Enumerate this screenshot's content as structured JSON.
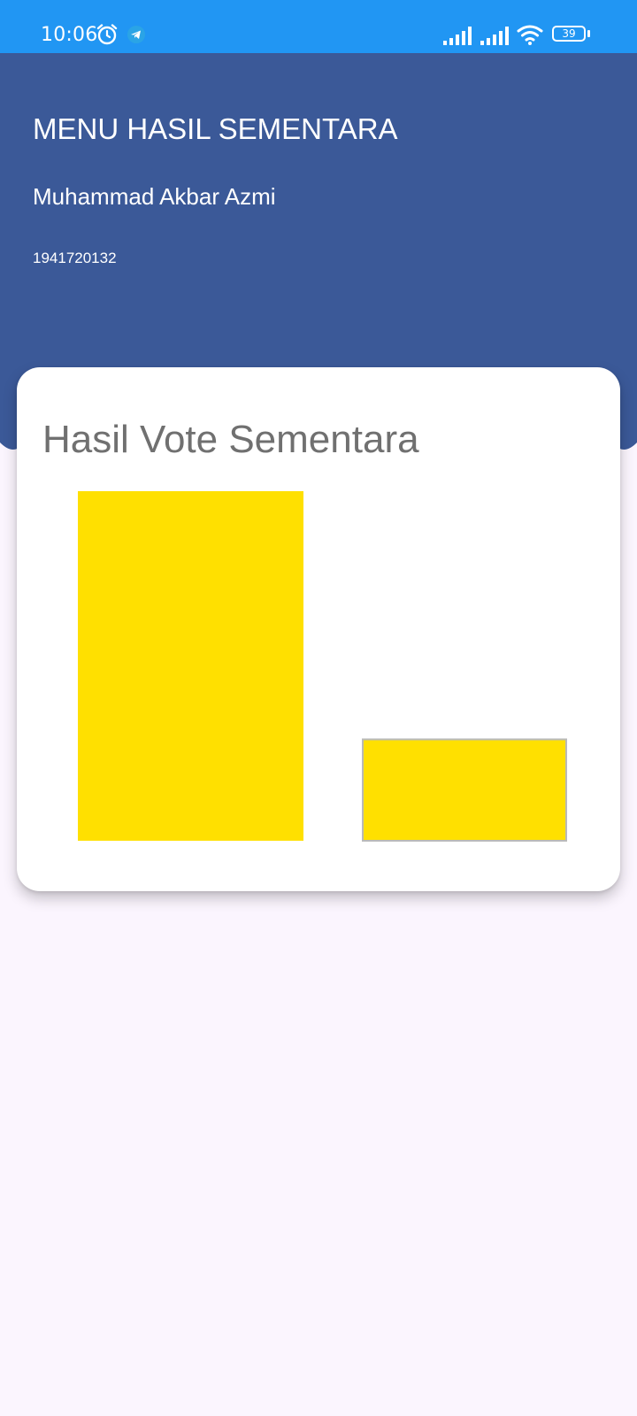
{
  "status_bar": {
    "time": "10:06",
    "battery": "39",
    "icons": [
      "alarm-icon",
      "telegram-icon",
      "signal-icon",
      "signal-icon",
      "wifi-icon",
      "battery-icon"
    ],
    "background": "#2196f3"
  },
  "header": {
    "title": "MENU HASIL SEMENTARA",
    "name": "Muhammad Akbar Azmi",
    "id": "1941720132",
    "background": "#3b5998"
  },
  "card": {
    "title": "Hasil Vote Sementara"
  },
  "chart_data": {
    "type": "bar",
    "categories": [
      "",
      ""
    ],
    "values": [
      1.0,
      0.29
    ],
    "title": "Hasil Vote Sementara",
    "xlabel": "",
    "ylabel": "",
    "ylim": [
      0,
      1.0
    ],
    "grid": false,
    "bar_color": "#ffe000"
  }
}
